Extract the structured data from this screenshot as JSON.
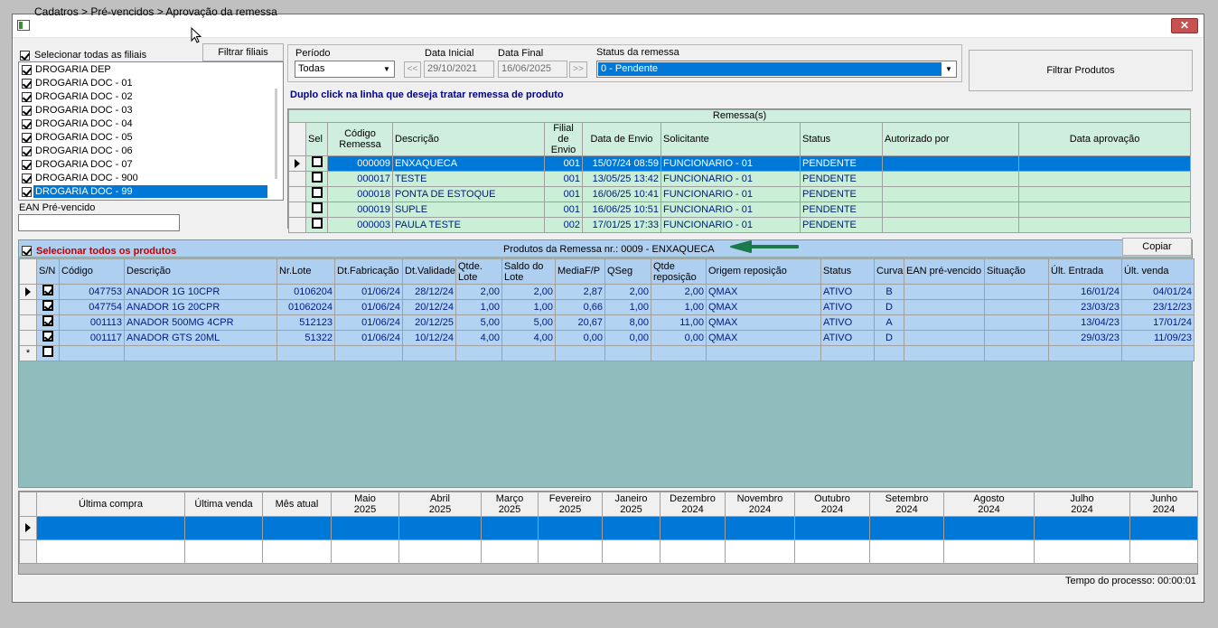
{
  "window": {
    "title": "Cadatros > Pré-vencidos > Aprovação da remessa",
    "close_label": "✕"
  },
  "branches": {
    "select_all_label": "Selecionar todas as filiais",
    "filter_button": "Filtrar filiais",
    "items": [
      {
        "label": "DROGARIA DEP",
        "checked": true
      },
      {
        "label": "DROGARIA DOC - 01",
        "checked": true
      },
      {
        "label": "DROGARIA DOC - 02",
        "checked": true
      },
      {
        "label": "DROGARIA DOC - 03",
        "checked": true
      },
      {
        "label": "DROGARIA DOC - 04",
        "checked": true
      },
      {
        "label": "DROGARIA DOC - 05",
        "checked": true
      },
      {
        "label": "DROGARIA DOC - 06",
        "checked": true
      },
      {
        "label": "DROGARIA DOC - 07",
        "checked": true
      },
      {
        "label": "DROGARIA DOC - 900",
        "checked": true
      },
      {
        "label": "DROGARIA DOC - 99",
        "checked": true,
        "selected": true
      }
    ],
    "ean_label": "EAN Pré-vencido",
    "ean_value": ""
  },
  "filters": {
    "period_label": "Período",
    "period_value": "Todas",
    "start_label": "Data Inicial",
    "start_value": "29/10/2021",
    "end_label": "Data Final",
    "end_value": "16/06/2025",
    "prev_btn": "<<",
    "next_btn": ">>",
    "status_label": "Status da remessa",
    "status_value": "0 - Pendente",
    "filter_products_button": "Filtrar Produtos"
  },
  "hint": "Duplo click na linha que deseja tratar remessa de produto",
  "remessas": {
    "caption": "Remessa(s)",
    "headers": [
      "Sel",
      "Código Remessa",
      "Descrição",
      "Filial de Envio",
      "Data de Envio",
      "Solicitante",
      "Status",
      "Autorizado por",
      "Data aprovação"
    ],
    "rows": [
      {
        "code": "000009",
        "desc": "ENXAQUECA",
        "filial": "001",
        "date": "15/07/24 08:59",
        "solic": "FUNCIONARIO - 01",
        "status": "PENDENTE",
        "auth": "",
        "aprov": ""
      },
      {
        "code": "000017",
        "desc": "TESTE",
        "filial": "001",
        "date": "13/05/25 13:42",
        "solic": "FUNCIONARIO - 01",
        "status": "PENDENTE",
        "auth": "",
        "aprov": ""
      },
      {
        "code": "000018",
        "desc": "PONTA DE ESTOQUE",
        "filial": "001",
        "date": "16/06/25 10:41",
        "solic": "FUNCIONARIO - 01",
        "status": "PENDENTE",
        "auth": "",
        "aprov": ""
      },
      {
        "code": "000019",
        "desc": "SUPLE",
        "filial": "001",
        "date": "16/06/25 10:51",
        "solic": "FUNCIONARIO - 01",
        "status": "PENDENTE",
        "auth": "",
        "aprov": ""
      },
      {
        "code": "000003",
        "desc": "PAULA TESTE",
        "filial": "002",
        "date": "17/01/25 17:33",
        "solic": "FUNCIONARIO - 01",
        "status": "PENDENTE",
        "auth": "",
        "aprov": ""
      }
    ]
  },
  "products": {
    "select_all_label": "Selecionar todos os produtos",
    "caption": "Produtos da Remessa nr.: 0009 - ENXAQUECA",
    "copy_button": "Copiar",
    "headers": [
      "S/N",
      "Código",
      "Descrição",
      "Nr.Lote",
      "Dt.Fabricação",
      "Dt.Validade",
      "Qtde. Lote",
      "Saldo do Lote",
      "MediaF/P",
      "QSeg",
      "Qtde reposição",
      "Origem reposição",
      "Status",
      "Curva",
      "EAN pré-vencido",
      "Situação",
      "Últ. Entrada",
      "Últ. venda"
    ],
    "rows": [
      {
        "code": "047753",
        "desc": "ANADOR 1G 10CPR",
        "lote": "0106204",
        "fab": "01/06/24",
        "val": "28/12/24",
        "qtde": "2,00",
        "saldo": "2,00",
        "media": "2,87",
        "qseg": "2,00",
        "repos": "2,00",
        "origem": "QMAX",
        "status": "ATIVO",
        "curva": "B",
        "ean": "",
        "sit": "",
        "entrada": "16/01/24",
        "venda": "04/01/24"
      },
      {
        "code": "047754",
        "desc": "ANADOR 1G 20CPR",
        "lote": "01062024",
        "fab": "01/06/24",
        "val": "20/12/24",
        "qtde": "1,00",
        "saldo": "1,00",
        "media": "0,66",
        "qseg": "1,00",
        "repos": "1,00",
        "origem": "QMAX",
        "status": "ATIVO",
        "curva": "D",
        "ean": "",
        "sit": "",
        "entrada": "23/03/23",
        "venda": "23/12/23"
      },
      {
        "code": "001113",
        "desc": "ANADOR 500MG 4CPR",
        "lote": "512123",
        "fab": "01/06/24",
        "val": "20/12/25",
        "qtde": "5,00",
        "saldo": "5,00",
        "media": "20,67",
        "qseg": "8,00",
        "repos": "11,00",
        "origem": "QMAX",
        "status": "ATIVO",
        "curva": "A",
        "ean": "",
        "sit": "",
        "entrada": "13/04/23",
        "venda": "17/01/24"
      },
      {
        "code": "001117",
        "desc": "ANADOR GTS 20ML",
        "lote": "51322",
        "fab": "01/06/24",
        "val": "10/12/24",
        "qtde": "4,00",
        "saldo": "4,00",
        "media": "0,00",
        "qseg": "0,00",
        "repos": "0,00",
        "origem": "QMAX",
        "status": "ATIVO",
        "curva": "D",
        "ean": "",
        "sit": "",
        "entrada": "29/03/23",
        "venda": "11/09/23"
      }
    ],
    "new_row_marker": "*"
  },
  "history": {
    "headers": [
      [
        "Última compra",
        ""
      ],
      [
        "Última venda",
        ""
      ],
      [
        "Mês atual",
        ""
      ],
      [
        "Maio",
        "2025"
      ],
      [
        "Abril",
        "2025"
      ],
      [
        "Março",
        "2025"
      ],
      [
        "Fevereiro",
        "2025"
      ],
      [
        "Janeiro",
        "2025"
      ],
      [
        "Dezembro",
        "2024"
      ],
      [
        "Novembro",
        "2024"
      ],
      [
        "Outubro",
        "2024"
      ],
      [
        "Setembro",
        "2024"
      ],
      [
        "Agosto",
        "2024"
      ],
      [
        "Julho",
        "2024"
      ],
      [
        "Junho",
        "2024"
      ]
    ]
  },
  "footer": {
    "process_time": "Tempo do processo: 00:00:01"
  },
  "colors": {
    "selection": "#0078d7",
    "remessa_row": "#c9f0d6",
    "product_row": "#b3d3f3",
    "product_area": "#8fbdbd",
    "highlight_red": "#c00000",
    "hint_blue": "#00008b",
    "arrow_green": "#1a7a4a"
  }
}
